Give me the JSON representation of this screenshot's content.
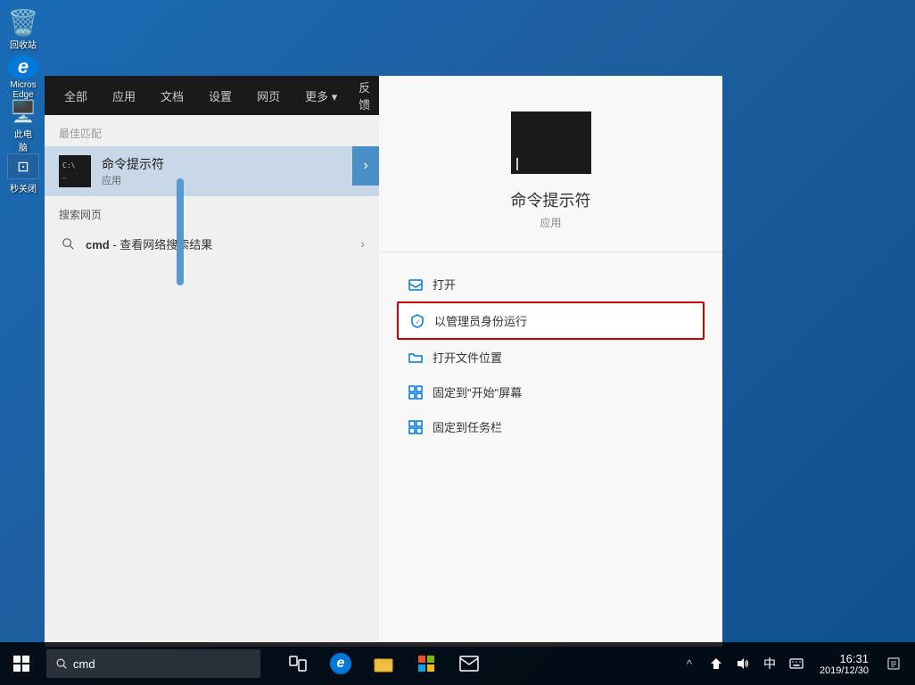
{
  "desktop": {
    "icons": [
      {
        "id": "recycle-bin",
        "label": "回收站",
        "icon": "🗑️"
      },
      {
        "id": "edge",
        "label": "Micros\nEdge",
        "icon": "e"
      },
      {
        "id": "computer",
        "label": "此电\n脑",
        "icon": "🖥️"
      },
      {
        "id": "shortcut",
        "label": "秒关闭\n...",
        "icon": "🔧"
      }
    ]
  },
  "search_panel": {
    "tabs": [
      "全部",
      "应用",
      "文档",
      "设置",
      "网页",
      "更多 ▾"
    ],
    "feedback": "反馈",
    "more": "···",
    "section_best": "最佳匹配",
    "section_web": "搜索网页",
    "best_match": {
      "name": "命令提示符",
      "type": "应用"
    },
    "web_item": {
      "prefix": "cmd",
      "suffix": " - 查看网络搜索结果"
    }
  },
  "app_detail": {
    "name": "命令提示符",
    "type": "应用",
    "actions": [
      {
        "id": "open",
        "label": "打开",
        "icon": "open"
      },
      {
        "id": "run-as-admin",
        "label": "以管理员身份运行",
        "icon": "shield",
        "highlighted": true
      },
      {
        "id": "open-location",
        "label": "打开文件位置",
        "icon": "folder"
      },
      {
        "id": "pin-start",
        "label": "固定到\"开始\"屏幕",
        "icon": "pin"
      },
      {
        "id": "pin-taskbar",
        "label": "固定到任务栏",
        "icon": "pin"
      }
    ]
  },
  "taskbar": {
    "search_placeholder": "cmd",
    "time": "16:31",
    "date": "2019/12/30",
    "tray_icons": [
      "^",
      "📶",
      "🔊",
      "中",
      "⊞"
    ]
  }
}
